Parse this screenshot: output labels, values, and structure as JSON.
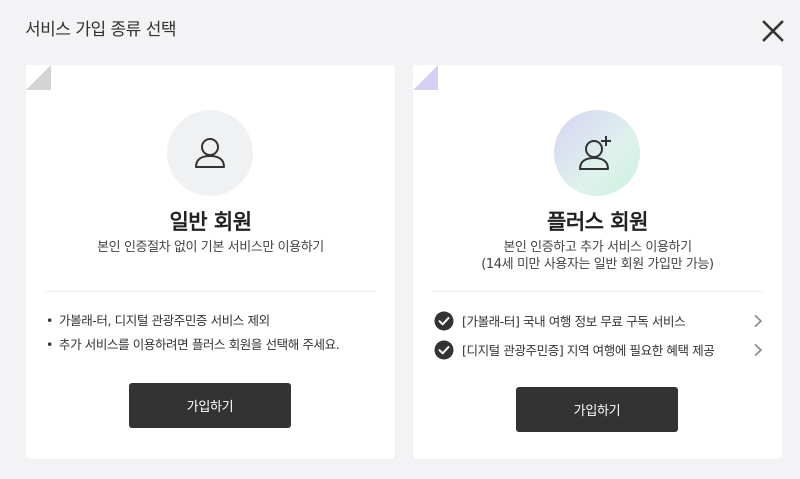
{
  "modal": {
    "title": "서비스 가입 종류 선택",
    "close_icon": "close-icon"
  },
  "plans": {
    "general": {
      "icon": "user-icon",
      "name": "일반 회원",
      "description": "본인 인증절차 없이 기본 서비스만 이용하기",
      "notes": [
        "가볼래-터, 디지털 관광주민증 서비스 제외",
        "추가 서비스를 이용하려면 플러스 회원을 선택해 주세요."
      ],
      "join_label": "가입하기"
    },
    "plus": {
      "icon": "user-plus-icon",
      "name": "플러스 회원",
      "description": "본인 인증하고 추가 서비스 이용하기",
      "description_sub": "(14세 미만 사용자는 일반 회원 가입만 가능)",
      "benefits": [
        "[가볼래-터] 국내 여행 정보 무료 구독 서비스",
        "[디지털 관광주민증] 지역 여행에 필요한 혜택 제공"
      ],
      "join_label": "가입하기"
    }
  },
  "colors": {
    "button_bg": "#333333",
    "corner_general": "#d4d4d4",
    "corner_plus": "#d6d0f5"
  }
}
